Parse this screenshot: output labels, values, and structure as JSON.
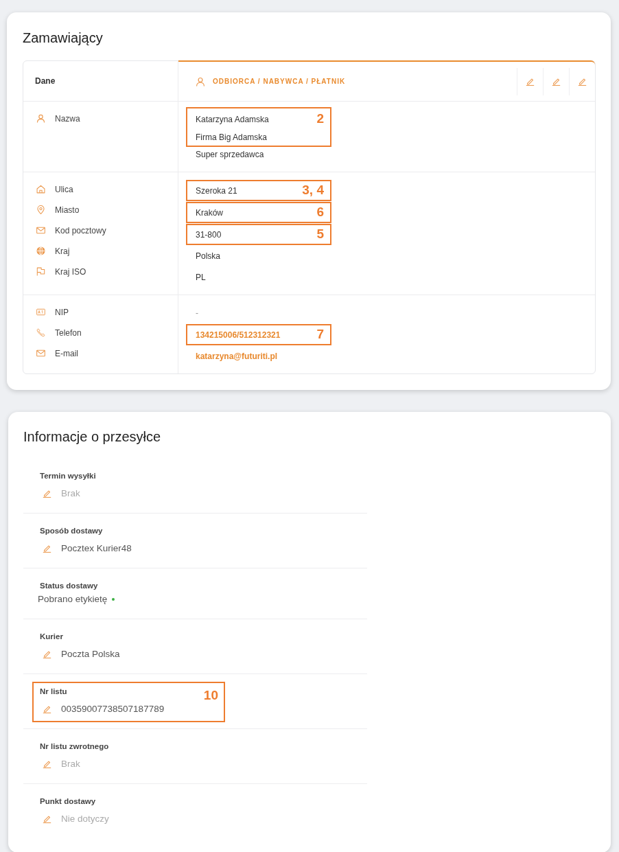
{
  "customer": {
    "title": "Zamawiający",
    "header": {
      "label": "Dane",
      "role": "ODBIORCA / NABYWCA / PŁATNIK",
      "actions": [
        {
          "kind": "edit"
        },
        {
          "kind": "edit"
        },
        {
          "kind": "edit"
        }
      ]
    },
    "sections": [
      {
        "labels": [
          {
            "kind": "name",
            "text": "Nazwa"
          }
        ],
        "values": [
          {
            "kind": "text",
            "callout": "2",
            "lines": [
              "Katarzyna Adamska",
              "Firma Big Adamska"
            ]
          },
          {
            "kind": "text",
            "lines": [
              "Super sprzedawca"
            ]
          }
        ]
      },
      {
        "labels": [
          {
            "kind": "street",
            "text": "Ulica"
          },
          {
            "kind": "city",
            "text": "Miasto"
          },
          {
            "kind": "postal_code",
            "text": "Kod pocztowy"
          },
          {
            "kind": "country",
            "text": "Kraj"
          },
          {
            "kind": "country_iso",
            "text": "Kraj ISO"
          }
        ],
        "values": [
          {
            "kind": "text",
            "callout": "3, 4",
            "lines": [
              "Szeroka 21"
            ]
          },
          {
            "kind": "text",
            "callout": "6",
            "lines": [
              "Kraków"
            ]
          },
          {
            "kind": "text",
            "callout": "5",
            "lines": [
              "31-800"
            ]
          },
          {
            "kind": "text",
            "lines": [
              "Polska"
            ]
          },
          {
            "kind": "text",
            "lines": [
              "PL"
            ]
          }
        ]
      },
      {
        "labels": [
          {
            "kind": "tax_id",
            "text": "NIP"
          },
          {
            "kind": "phone",
            "text": "Telefon"
          },
          {
            "kind": "email",
            "text": "E-mail"
          }
        ],
        "values": [
          {
            "kind": "muted",
            "lines": [
              "-"
            ]
          },
          {
            "kind": "link",
            "callout": "7",
            "lines": [
              "134215006/512312321"
            ]
          },
          {
            "kind": "link",
            "lines": [
              "katarzyna@futuriti.pl"
            ]
          }
        ]
      }
    ]
  },
  "shipment": {
    "title": "Informacje o przesyłce",
    "fields": [
      {
        "kind": "editable",
        "label": "Termin wysyłki",
        "value": "Brak",
        "unset": true
      },
      {
        "kind": "editable",
        "label": "Sposób dostawy",
        "value": "Pocztex Kurier48",
        "unset": false
      },
      {
        "kind": "status",
        "label": "Status dostawy",
        "value": "Pobrano etykietę",
        "color": "#3cb043"
      },
      {
        "kind": "editable",
        "label": "Kurier",
        "value": "Poczta Polska",
        "unset": false
      },
      {
        "kind": "editable",
        "label": "Nr listu",
        "value": "00359007738507187789",
        "unset": false,
        "callout": "10"
      },
      {
        "kind": "editable",
        "label": "Nr listu zwrotnego",
        "value": "Brak",
        "unset": true
      },
      {
        "kind": "editable",
        "label": "Punkt dostawy",
        "value": "Nie dotyczy",
        "unset": true
      }
    ]
  }
}
